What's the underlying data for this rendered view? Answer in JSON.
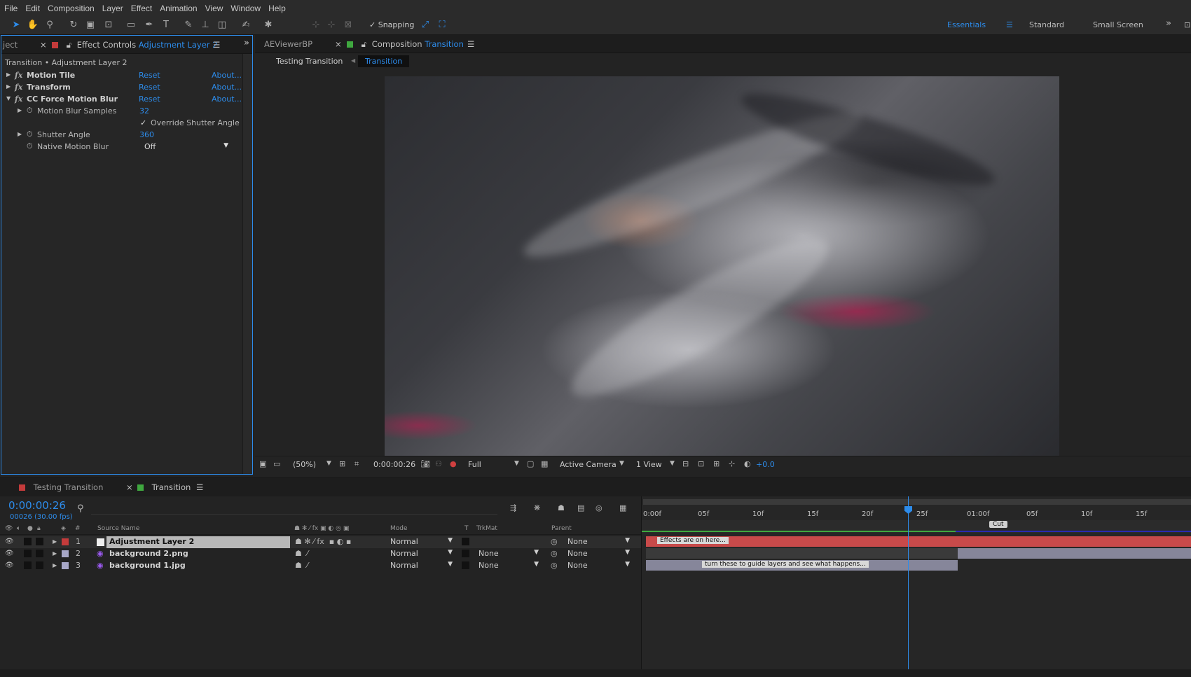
{
  "menu": [
    "File",
    "Edit",
    "Composition",
    "Layer",
    "Effect",
    "Animation",
    "View",
    "Window",
    "Help"
  ],
  "toolbar": {
    "snapping_label": "Snapping",
    "workspaces": {
      "active": "Essentials",
      "items": [
        "Standard",
        "Small Screen"
      ]
    }
  },
  "effect_controls": {
    "tab_left_partial": "ject",
    "tab_title": "Effect Controls",
    "tab_layer": "Adjustment Layer 2",
    "breadcrumb": "Transition • Adjustment Layer 2",
    "effects": [
      {
        "name": "Motion Tile",
        "reset": "Reset",
        "about": "About..."
      },
      {
        "name": "Transform",
        "reset": "Reset",
        "about": "About..."
      },
      {
        "name": "CC Force Motion Blur",
        "reset": "Reset",
        "about": "About..."
      }
    ],
    "properties": {
      "motion_blur_samples": {
        "label": "Motion Blur Samples",
        "value": "32"
      },
      "override_shutter": {
        "label": "Override Shutter Angle",
        "checked": true
      },
      "shutter_angle": {
        "label": "Shutter Angle",
        "value": "360"
      },
      "native_motion_blur": {
        "label": "Native Motion Blur",
        "value": "Off"
      }
    }
  },
  "composition": {
    "tab_viewer": "AEViewerBP",
    "tab_title": "Composition",
    "tab_comp": "Transition",
    "nav": [
      "Testing Transition",
      "Transition"
    ],
    "controls": {
      "zoom": "(50%)",
      "timecode": "0:00:00:26",
      "resolution": "Full",
      "camera": "Active Camera",
      "views": "1 View",
      "exposure": "+0.0"
    }
  },
  "timeline": {
    "tabs": [
      "Testing Transition",
      "Transition"
    ],
    "timecode": "0:00:00:26",
    "frame_info": "00026 (30.00 fps)",
    "headers": {
      "num": "#",
      "source": "Source Name",
      "mode": "Mode",
      "t": "T",
      "trkmat": "TrkMat",
      "parent": "Parent"
    },
    "layers": [
      {
        "num": "1",
        "name": "Adjustment Layer 2",
        "mode": "Normal",
        "trkmat": "",
        "parent": "None",
        "color": "#c43b3b"
      },
      {
        "num": "2",
        "name": "background 2.png",
        "mode": "Normal",
        "trkmat": "None",
        "parent": "None",
        "color": "#a8a8c8"
      },
      {
        "num": "3",
        "name": "background 1.jpg",
        "mode": "Normal",
        "trkmat": "None",
        "parent": "None",
        "color": "#a8a8c8"
      }
    ],
    "ruler": [
      "0:00f",
      "05f",
      "10f",
      "15f",
      "20f",
      "25f",
      "01:00f",
      "05f",
      "10f",
      "15f"
    ],
    "markers": {
      "cut": "Cut",
      "effects_note": "Effects are on here...",
      "guide_note": "turn these to guide layers and see what happens..."
    },
    "playhead_frame": 26
  }
}
